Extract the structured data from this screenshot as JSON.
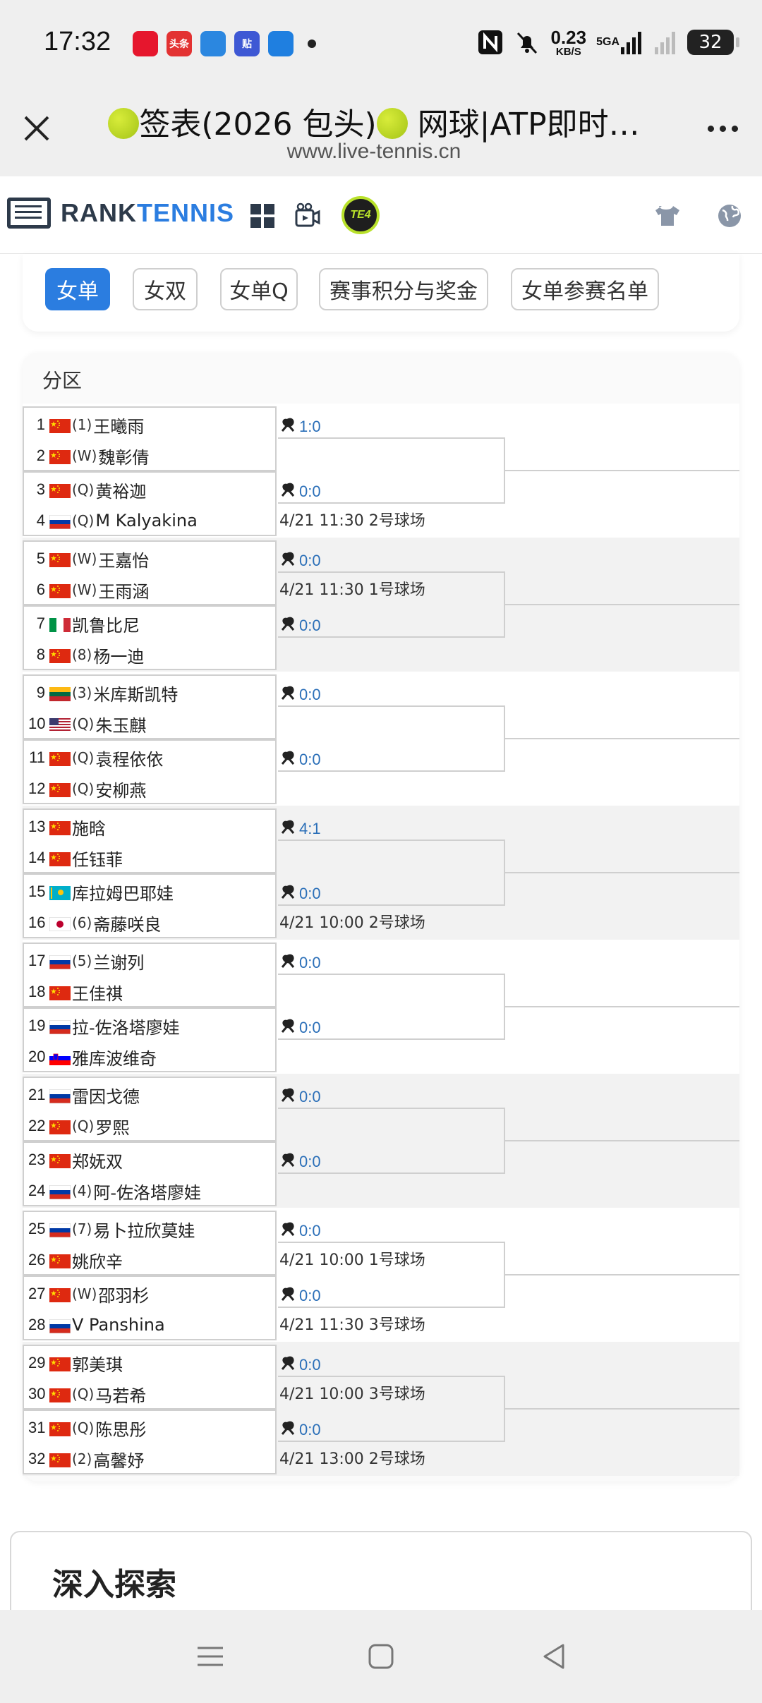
{
  "status_bar": {
    "time": "17:32",
    "app_icons": [
      {
        "name": "weibo-icon",
        "color": "#e6162d",
        "text": ""
      },
      {
        "name": "toutiao-icon",
        "color": "#e33232",
        "text": "头条"
      },
      {
        "name": "browser-icon",
        "color": "#2b87e0",
        "text": ""
      },
      {
        "name": "tieba-icon",
        "color": "#3e58d4",
        "text": "贴"
      },
      {
        "name": "news-icon",
        "color": "#1f7fe0",
        "text": ""
      }
    ],
    "net_speed": "0.23",
    "net_speed_unit": "KB/S",
    "network": "5GA",
    "battery": "32"
  },
  "browser": {
    "title": "签表(2026 包头) 网球|ATP即时…",
    "title_part1": "签表(2026 包头)",
    "title_part2": "网球|ATP即时…",
    "url": "www.live-tennis.cn"
  },
  "site": {
    "logo_part1": "RANK",
    "logo_part2": "TENNIS",
    "te4_label": "TE4"
  },
  "tabs": [
    {
      "label": "女单",
      "active": true
    },
    {
      "label": "女双",
      "active": false
    },
    {
      "label": "女单Q",
      "active": false
    },
    {
      "label": "赛事积分与奖金",
      "active": false
    },
    {
      "label": "女单参赛名单",
      "active": false
    }
  ],
  "section_title": "分区",
  "flags": {
    "CN": "#de2910",
    "RU": "russia",
    "IT": "italy",
    "LT": "lithuania",
    "US": "usa",
    "KZ": "kazakhstan",
    "JP": "japan",
    "SI": "slovenia"
  },
  "players": [
    {
      "num": "1",
      "flag": "CN",
      "seed": "(1)",
      "name": "王曦雨"
    },
    {
      "num": "2",
      "flag": "CN",
      "seed": "(W)",
      "name": "魏彰倩"
    },
    {
      "num": "3",
      "flag": "CN",
      "seed": "(Q)",
      "name": "黄裕迦"
    },
    {
      "num": "4",
      "flag": "RU",
      "seed": "(Q)",
      "name": "M Kalyakina"
    },
    {
      "num": "5",
      "flag": "CN",
      "seed": "(W)",
      "name": "王嘉怡"
    },
    {
      "num": "6",
      "flag": "CN",
      "seed": "(W)",
      "name": "王雨涵"
    },
    {
      "num": "7",
      "flag": "IT",
      "seed": "",
      "name": "凯鲁比尼"
    },
    {
      "num": "8",
      "flag": "CN",
      "seed": "(8)",
      "name": "杨一迪"
    },
    {
      "num": "9",
      "flag": "LT",
      "seed": "(3)",
      "name": "米库斯凯特"
    },
    {
      "num": "10",
      "flag": "US",
      "seed": "(Q)",
      "name": "朱玉麒"
    },
    {
      "num": "11",
      "flag": "CN",
      "seed": "(Q)",
      "name": "袁程依依"
    },
    {
      "num": "12",
      "flag": "CN",
      "seed": "(Q)",
      "name": "安柳燕"
    },
    {
      "num": "13",
      "flag": "CN",
      "seed": "",
      "name": "施晗"
    },
    {
      "num": "14",
      "flag": "CN",
      "seed": "",
      "name": "任钰菲"
    },
    {
      "num": "15",
      "flag": "KZ",
      "seed": "",
      "name": "库拉姆巴耶娃"
    },
    {
      "num": "16",
      "flag": "JP",
      "seed": "(6)",
      "name": "斋藤咲良"
    },
    {
      "num": "17",
      "flag": "RU",
      "seed": "(5)",
      "name": "兰谢列"
    },
    {
      "num": "18",
      "flag": "CN",
      "seed": "",
      "name": "王佳祺"
    },
    {
      "num": "19",
      "flag": "RU",
      "seed": "",
      "name": "拉-佐洛塔廖娃"
    },
    {
      "num": "20",
      "flag": "SI",
      "seed": "",
      "name": "雅库波维奇"
    },
    {
      "num": "21",
      "flag": "RU",
      "seed": "",
      "name": "雷因戈德"
    },
    {
      "num": "22",
      "flag": "CN",
      "seed": "(Q)",
      "name": "罗熙"
    },
    {
      "num": "23",
      "flag": "CN",
      "seed": "",
      "name": "郑妩双"
    },
    {
      "num": "24",
      "flag": "RU",
      "seed": "(4)",
      "name": "阿-佐洛塔廖娃"
    },
    {
      "num": "25",
      "flag": "RU",
      "seed": "(7)",
      "name": "易卜拉欣莫娃"
    },
    {
      "num": "26",
      "flag": "CN",
      "seed": "",
      "name": "姚欣辛"
    },
    {
      "num": "27",
      "flag": "CN",
      "seed": "(W)",
      "name": "邵羽杉"
    },
    {
      "num": "28",
      "flag": "RU",
      "seed": "",
      "name": "V Panshina"
    },
    {
      "num": "29",
      "flag": "CN",
      "seed": "",
      "name": "郭美琪"
    },
    {
      "num": "30",
      "flag": "CN",
      "seed": "(Q)",
      "name": "马若希"
    },
    {
      "num": "31",
      "flag": "CN",
      "seed": "(Q)",
      "name": "陈思彤"
    },
    {
      "num": "32",
      "flag": "CN",
      "seed": "(2)",
      "name": "高馨妤"
    }
  ],
  "matches": [
    {
      "score": "1:0",
      "schedule": ""
    },
    {
      "score": "0:0",
      "schedule": "4/21 11:30 2号球场"
    },
    {
      "score": "0:0",
      "schedule": "4/21 11:30 1号球场"
    },
    {
      "score": "0:0",
      "schedule": ""
    },
    {
      "score": "0:0",
      "schedule": ""
    },
    {
      "score": "0:0",
      "schedule": ""
    },
    {
      "score": "4:1",
      "schedule": ""
    },
    {
      "score": "0:0",
      "schedule": "4/21 10:00 2号球场"
    },
    {
      "score": "0:0",
      "schedule": ""
    },
    {
      "score": "0:0",
      "schedule": ""
    },
    {
      "score": "0:0",
      "schedule": ""
    },
    {
      "score": "0:0",
      "schedule": ""
    },
    {
      "score": "0:0",
      "schedule": "4/21 10:00 1号球场"
    },
    {
      "score": "0:0",
      "schedule": "4/21 11:30 3号球场"
    },
    {
      "score": "0:0",
      "schedule": "4/21 10:00 3号球场"
    },
    {
      "score": "0:0",
      "schedule": "4/21 13:00 2号球场"
    }
  ],
  "explore_title": "深入探索"
}
